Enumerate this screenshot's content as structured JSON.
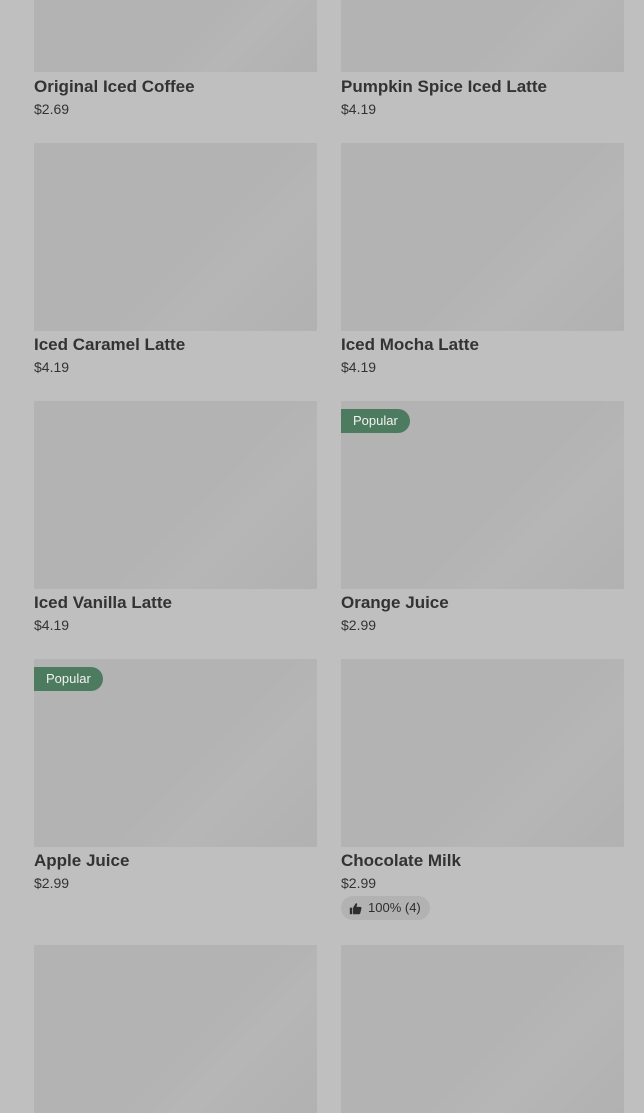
{
  "items": [
    {
      "name": "Original Iced Coffee",
      "price": "$2.69"
    },
    {
      "name": "Pumpkin Spice Iced Latte",
      "price": "$4.19"
    },
    {
      "name": "Iced Caramel Latte",
      "price": "$4.19"
    },
    {
      "name": "Iced Mocha Latte",
      "price": "$4.19"
    },
    {
      "name": "Iced Vanilla Latte",
      "price": "$4.19"
    },
    {
      "name": "Orange Juice",
      "price": "$2.99",
      "badge": "Popular"
    },
    {
      "name": "Apple Juice",
      "price": "$2.99",
      "badge": "Popular"
    },
    {
      "name": "Chocolate Milk",
      "price": "$2.99",
      "rating": "100% (4)"
    },
    {
      "name": "",
      "price": ""
    },
    {
      "name": "",
      "price": ""
    }
  ],
  "icons": {
    "rating": "thumbs-up-icon"
  },
  "colors": {
    "badge": "#4d7b5f",
    "background": "#bfbfbf",
    "image_placeholder": "#b3b3b3"
  }
}
